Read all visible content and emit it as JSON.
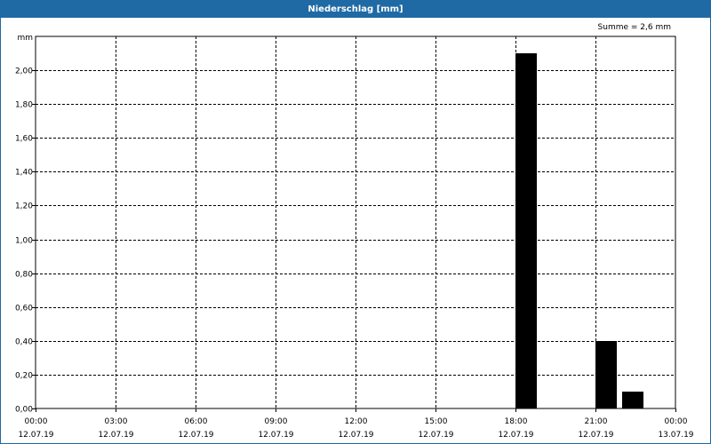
{
  "window": {
    "title": "Niederschlag [mm]",
    "sum_label": "Summe = 2,6 mm"
  },
  "colors": {
    "title_bar": "#1f6aa5",
    "bars": "#000000",
    "grid": "#000000"
  },
  "chart_data": {
    "type": "bar",
    "title": "Niederschlag [mm]",
    "ylabel": "mm",
    "xlabel": "",
    "ylim": [
      0,
      2.2
    ],
    "xlim_hours": [
      0,
      24
    ],
    "grid": true,
    "y_ticks": [
      {
        "value": 0.0,
        "label": "0,00"
      },
      {
        "value": 0.2,
        "label": "0,20"
      },
      {
        "value": 0.4,
        "label": "0,40"
      },
      {
        "value": 0.6,
        "label": "0,60"
      },
      {
        "value": 0.8,
        "label": "0,80"
      },
      {
        "value": 1.0,
        "label": "1,00"
      },
      {
        "value": 1.2,
        "label": "1,20"
      },
      {
        "value": 1.4,
        "label": "1,40"
      },
      {
        "value": 1.6,
        "label": "1,60"
      },
      {
        "value": 1.8,
        "label": "1,80"
      },
      {
        "value": 2.0,
        "label": "2,00"
      }
    ],
    "x_ticks": [
      {
        "hour": 0,
        "time": "00:00",
        "date": "12.07.19"
      },
      {
        "hour": 3,
        "time": "03:00",
        "date": "12.07.19"
      },
      {
        "hour": 6,
        "time": "06:00",
        "date": "12.07.19"
      },
      {
        "hour": 9,
        "time": "09:00",
        "date": "12.07.19"
      },
      {
        "hour": 12,
        "time": "12:00",
        "date": "12.07.19"
      },
      {
        "hour": 15,
        "time": "15:00",
        "date": "12.07.19"
      },
      {
        "hour": 18,
        "time": "18:00",
        "date": "12.07.19"
      },
      {
        "hour": 21,
        "time": "21:00",
        "date": "12.07.19"
      },
      {
        "hour": 24,
        "time": "00:00",
        "date": "13.07.19"
      }
    ],
    "bars": [
      {
        "start_hour": 18.0,
        "end_hour": 18.75,
        "value": 2.1
      },
      {
        "start_hour": 21.0,
        "end_hour": 21.75,
        "value": 0.4
      },
      {
        "start_hour": 22.0,
        "end_hour": 22.75,
        "value": 0.1
      }
    ],
    "sum_label": "Summe = 2,6 mm"
  }
}
